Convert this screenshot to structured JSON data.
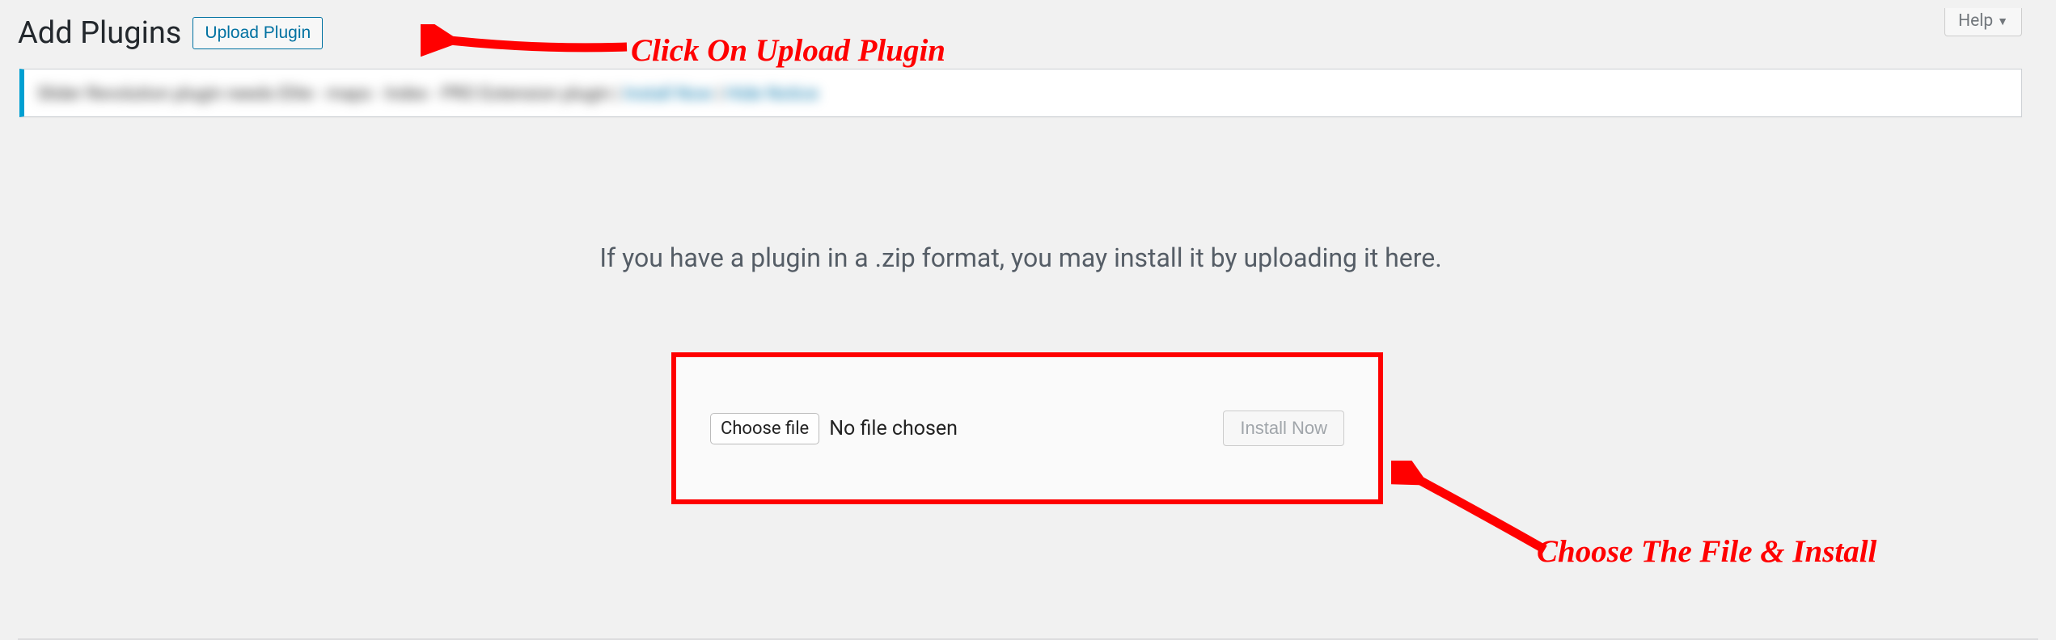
{
  "header": {
    "title": "Add Plugins",
    "upload_button": "Upload Plugin",
    "help_tab": "Help"
  },
  "main": {
    "instruction": "If you have a plugin in a .zip format, you may install it by uploading it here.",
    "choose_file_button": "Choose file",
    "file_status": "No file chosen",
    "install_button": "Install Now"
  },
  "annotations": {
    "upload_hint": "Click On Upload Plugin",
    "install_hint": "Choose The File & Install"
  }
}
